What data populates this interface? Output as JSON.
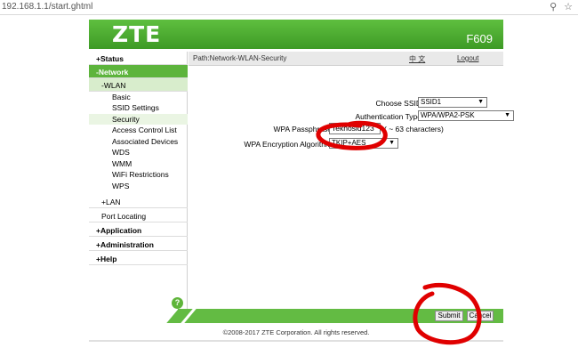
{
  "browser": {
    "url": "192.168.1.1/start.ghtml"
  },
  "header": {
    "logo": "ZTE",
    "model": "F609"
  },
  "sidebar": {
    "status": "+Status",
    "network": "-Network",
    "wlan": "-WLAN",
    "wlan_items": [
      "Basic",
      "SSID Settings",
      "Security",
      "Access Control List",
      "Associated Devices",
      "WDS",
      "WMM",
      "WiFi Restrictions",
      "WPS"
    ],
    "lan": "+LAN",
    "port_locating": "Port Locating",
    "application": "+Application",
    "administration": "+Administration",
    "help": "+Help",
    "help_icon": "?"
  },
  "pathbar": {
    "path": "Path:Network-WLAN-Security",
    "lang": "中 文",
    "logout": "Logout"
  },
  "form": {
    "ssid_label": "Choose SSID",
    "ssid_value": "SSID1",
    "auth_label": "Authentication Type",
    "auth_value": "WPA/WPA2-PSK",
    "pass_label": "WPA Passphrase",
    "pass_value": "Teknosid123",
    "pass_hint": "( ~ 63 characters)",
    "enc_label": "WPA Encryption Algorithm",
    "enc_value": "TKIP+AES"
  },
  "actions": {
    "submit": "Submit",
    "cancel": "Cancel"
  },
  "footer": {
    "copyright": "©2008-2017 ZTE Corporation. All rights reserved."
  },
  "colors": {
    "brand_green": "#3d9a25",
    "annotation_red": "#e00000"
  }
}
